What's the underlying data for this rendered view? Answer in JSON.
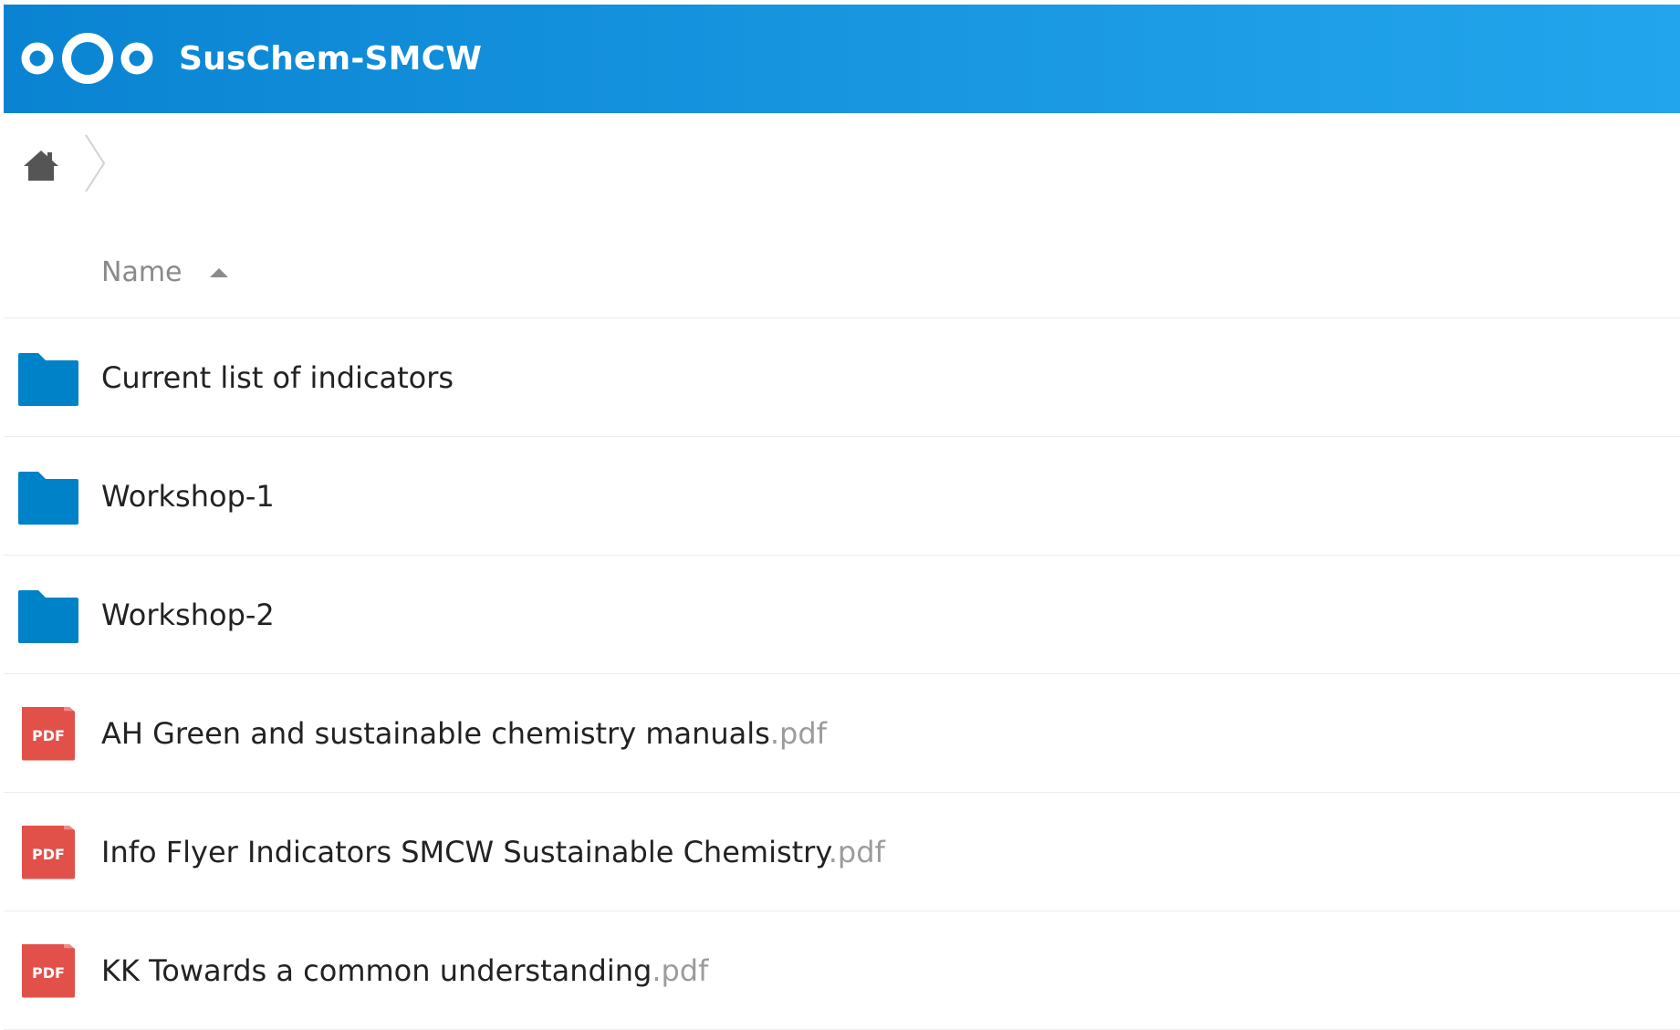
{
  "header": {
    "app_name": "SusChem-SMCW",
    "brand_color": "#0a84d2"
  },
  "breadcrumb": {
    "home_icon": "home-icon",
    "separator_icon": "chevron-right-icon"
  },
  "list": {
    "sort_column": "Name",
    "sort_direction": "ascending",
    "rows": [
      {
        "type": "folder",
        "icon": "folder-icon",
        "name": "Current list of indicators",
        "ext": ""
      },
      {
        "type": "folder",
        "icon": "folder-icon",
        "name": "Workshop-1",
        "ext": ""
      },
      {
        "type": "folder",
        "icon": "folder-icon",
        "name": "Workshop-2",
        "ext": ""
      },
      {
        "type": "file",
        "icon": "pdf-file-icon",
        "icon_label": "PDF",
        "name": "AH Green and sustainable chemistry manuals",
        "ext": ".pdf"
      },
      {
        "type": "file",
        "icon": "pdf-file-icon",
        "icon_label": "PDF",
        "name": "Info Flyer Indicators SMCW Sustainable Chemistry",
        "ext": ".pdf"
      },
      {
        "type": "file",
        "icon": "pdf-file-icon",
        "icon_label": "PDF",
        "name": "KK Towards a common understanding",
        "ext": ".pdf"
      }
    ]
  },
  "colors": {
    "folder": "#0082c9",
    "pdf": "#e2504a",
    "text": "#222222",
    "muted": "#9b9b9b"
  }
}
